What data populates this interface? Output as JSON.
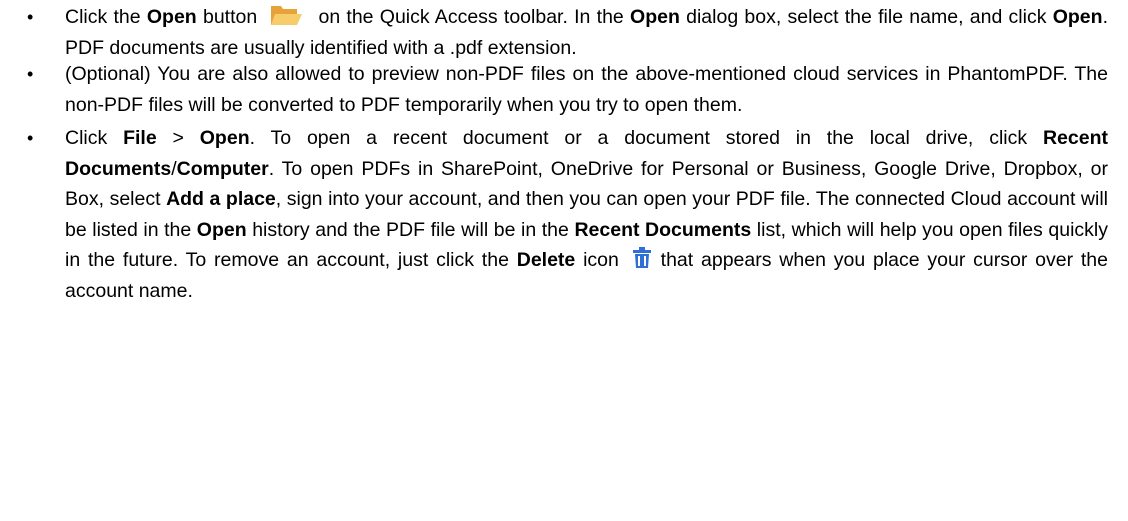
{
  "bullets": {
    "symbol": "•",
    "item1": {
      "t1": "Click the ",
      "b1": "Open",
      "t2": " button",
      "t3": "on the Quick Access toolbar. In the ",
      "b2": "Open",
      "t4": " dialog box, select the file name, and click ",
      "b3": "Open",
      "t5": ". PDF documents are usually identified with a .pdf extension."
    },
    "item2": {
      "t1": "(Optional) You are also allowed to preview non-PDF files on the above-mentioned cloud services in PhantomPDF. The non-PDF files will be converted to PDF temporarily when you try to open them."
    },
    "item3": {
      "t1": "Click ",
      "b1": "File",
      "t2": " > ",
      "b2": "Open",
      "t3": ". To open a recent document or a document stored in the local drive, click ",
      "b3": "Recent Documents",
      "t4": "/",
      "b4": "Computer",
      "t5": ". To open PDFs in SharePoint, OneDrive for Personal or Business, Google Drive, Dropbox, or Box, select ",
      "b5": "Add a place",
      "t6": ", sign into your account, and then you can open your PDF file. The connected Cloud account will be listed in the ",
      "b6": "Open",
      "t7": " history and the PDF file will be in the ",
      "b7": "Recent Documents",
      "t8": " list, which will help you open files quickly in the future. To remove an account, just click the ",
      "b8": "Delete",
      "t9": " icon",
      "t10": "that appears when you place your cursor over the account name."
    }
  },
  "icons": {
    "open_button_icon": "open-folder-icon",
    "delete_icon": "trash-icon"
  },
  "colors": {
    "folder_dark": "#E8A23A",
    "folder_light": "#F7CC6B",
    "delete_blue": "#2F6FD6"
  }
}
